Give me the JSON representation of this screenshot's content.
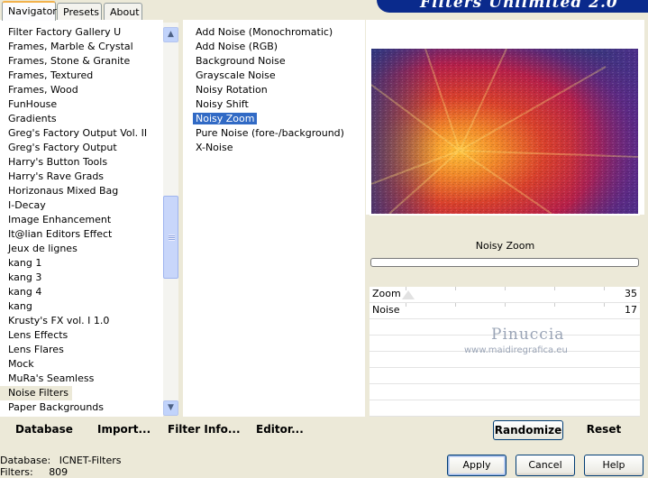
{
  "banner": {
    "title": "Filters Unlimited 2.0"
  },
  "tabs": [
    {
      "label": "Navigator"
    },
    {
      "label": "Presets"
    },
    {
      "label": "About"
    }
  ],
  "categories": {
    "selected_index": 25,
    "items": [
      "Filter Factory Gallery U",
      "Frames, Marble & Crystal",
      "Frames, Stone & Granite",
      "Frames, Textured",
      "Frames, Wood",
      "FunHouse",
      "Gradients",
      "Greg's Factory Output Vol. II",
      "Greg's Factory Output",
      "Harry's Button Tools",
      "Harry's Rave Grads",
      "Horizonaus Mixed Bag",
      "I-Decay",
      "Image Enhancement",
      "It@lian Editors Effect",
      "Jeux de lignes",
      "kang 1",
      "kang 3",
      "kang 4",
      "kang",
      "Krusty's FX vol. I 1.0",
      "Lens Effects",
      "Lens Flares",
      "Mock",
      "MuRa's Seamless",
      "Noise Filters",
      "Paper Backgrounds"
    ]
  },
  "filters": {
    "selected_index": 6,
    "items": [
      "Add Noise (Monochromatic)",
      "Add Noise (RGB)",
      "Background Noise",
      "Grayscale Noise",
      "Noisy Rotation",
      "Noisy Shift",
      "Noisy Zoom",
      "Pure Noise (fore-/background)",
      "X-Noise"
    ]
  },
  "nav_buttons": {
    "database": "Database",
    "import": "Import...",
    "filter_info": "Filter Info...",
    "editor": "Editor..."
  },
  "preview": {
    "filter_name": "Noisy Zoom"
  },
  "sliders": [
    {
      "label": "Zoom",
      "value": "35"
    },
    {
      "label": "Noise",
      "value": "17"
    }
  ],
  "watermark": {
    "name": "Pinuccia",
    "url": "www.maidiregrafica.eu"
  },
  "action_buttons": {
    "randomize": "Randomize",
    "reset": "Reset"
  },
  "status": {
    "database_label": "Database:",
    "database_value": "ICNET-Filters",
    "filters_label": "Filters:",
    "filters_value": "809"
  },
  "dialog_buttons": {
    "apply": "Apply",
    "cancel": "Cancel",
    "help": "Help"
  },
  "colors": {
    "selection": "#316ac5",
    "banner": "#0a2a8c",
    "window_bg": "#ece9d8"
  }
}
